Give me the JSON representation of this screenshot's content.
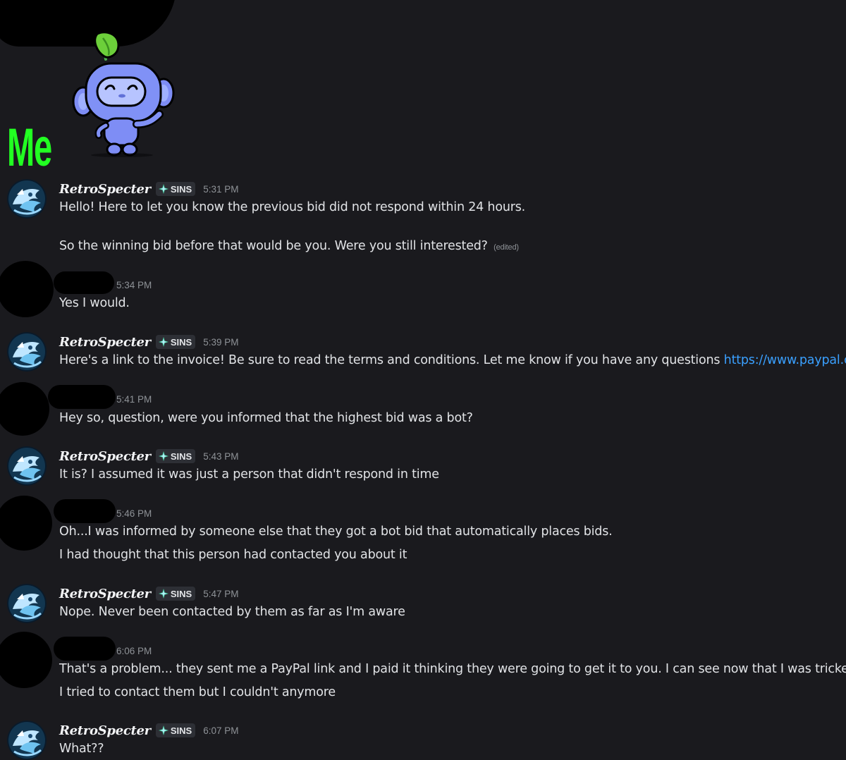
{
  "header_label": "Me",
  "colors": {
    "background": "#1a1a1e",
    "me_label": "#22ff22",
    "link": "#3aa0ff",
    "timestamp": "#8e9297"
  },
  "icons": {
    "sticker": "discord-wumpus-sprout-sticker",
    "tag": "four-point-star-tag-icon",
    "avatar": "blue-dragon-avatar"
  },
  "messages": [
    {
      "author": "RetroSpecter",
      "tag": "SINS",
      "time": "5:31 PM",
      "lines": [
        "Hello! Here to let you know the previous bid did not respond within 24 hours.",
        "So the winning bid before that would be you. Were you still interested?"
      ],
      "edited_label": "(edited)"
    },
    {
      "author": "",
      "time": "5:34 PM",
      "lines": [
        "Yes I would."
      ]
    },
    {
      "author": "RetroSpecter",
      "tag": "SINS",
      "time": "5:39 PM",
      "lines": [
        "Here's a link to the invoice! Be sure to read the terms and conditions. Let me know if you have any questions"
      ],
      "link": "https://www.paypal.com"
    },
    {
      "author": "",
      "time": "5:41 PM",
      "lines": [
        "Hey so, question, were you informed that the highest bid was a bot?"
      ]
    },
    {
      "author": "RetroSpecter",
      "tag": "SINS",
      "time": "5:43 PM",
      "lines": [
        "It is? I assumed it was just a person that didn't respond in time"
      ]
    },
    {
      "author": "",
      "time": "5:46 PM",
      "lines": [
        "Oh...I was informed by someone else that they got a bot bid that automatically places bids.",
        "I had thought that this person had contacted you about it"
      ]
    },
    {
      "author": "RetroSpecter",
      "tag": "SINS",
      "time": "5:47 PM",
      "lines": [
        "Nope. Never been contacted by them as far as I'm aware"
      ]
    },
    {
      "author": "",
      "time": "6:06 PM",
      "lines": [
        "That's a problem... they sent me a PayPal link and I paid it thinking they were going to get it to you. I can see now that I was tricked...",
        "I tried to contact them but I couldn't anymore"
      ]
    },
    {
      "author": "RetroSpecter",
      "tag": "SINS",
      "time": "6:07 PM",
      "lines": [
        "What??"
      ]
    }
  ]
}
